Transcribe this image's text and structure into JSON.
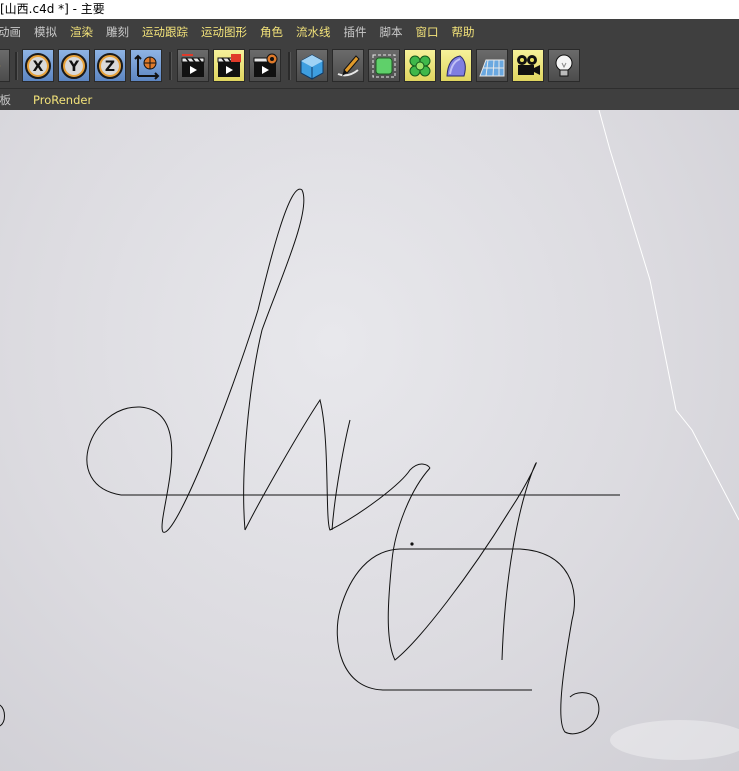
{
  "window": {
    "title": "[山西.c4d *] - 主要"
  },
  "menubar": {
    "items": [
      {
        "label": "动画",
        "color": "#c9c9c9"
      },
      {
        "label": "模拟",
        "color": "#c9c9c9"
      },
      {
        "label": "渲染",
        "color": "#f3e37a"
      },
      {
        "label": "雕刻",
        "color": "#c9c9c9"
      },
      {
        "label": "运动跟踪",
        "color": "#f3e37a"
      },
      {
        "label": "运动图形",
        "color": "#f3e37a"
      },
      {
        "label": "角色",
        "color": "#f3e37a"
      },
      {
        "label": "流水线",
        "color": "#f3e37a"
      },
      {
        "label": "插件",
        "color": "#c9c9c9"
      },
      {
        "label": "脚本",
        "color": "#c9c9c9"
      },
      {
        "label": "窗口",
        "color": "#f3e37a"
      },
      {
        "label": "帮助",
        "color": "#f3e37a"
      }
    ]
  },
  "toolbar": {
    "axis_x": "X",
    "axis_y": "Y",
    "axis_z": "Z",
    "icons": [
      "world-axis-icon",
      "render-view-icon",
      "render-picture-viewer-icon",
      "render-settings-icon",
      "cube-icon",
      "pen-spline-icon",
      "subdivision-icon",
      "cloner-icon",
      "deformer-icon",
      "floor-icon",
      "camera-icon",
      "light-icon"
    ]
  },
  "subbar": {
    "panel_label": "面板",
    "prorender_label": "ProRender",
    "panel_color": "#c9c9c9",
    "prorender_color": "#f3e37a"
  },
  "viewport": {
    "background": "#dcdbe0",
    "stroke_color": "#111111",
    "edge_color": "#ffffff"
  }
}
